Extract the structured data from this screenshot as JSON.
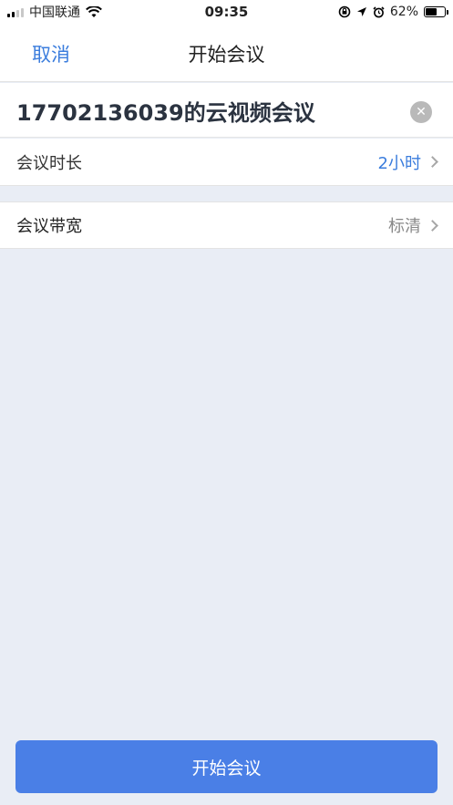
{
  "status_bar": {
    "carrier": "中国联通",
    "time": "09:35",
    "battery_percent_text": "62%",
    "battery_level": 0.62,
    "icons": [
      "signal-bars-icon",
      "wifi-icon",
      "screen-lock-rotation-icon",
      "location-arrow-icon",
      "alarm-clock-icon",
      "battery-icon"
    ]
  },
  "nav": {
    "cancel_label": "取消",
    "title": "开始会议"
  },
  "meeting": {
    "name_value": "17702136039的云视频会议"
  },
  "settings": {
    "duration_label": "会议时长",
    "duration_value": "2小时",
    "bandwidth_label": "会议带宽",
    "bandwidth_value": "标清"
  },
  "actions": {
    "start_label": "开始会议"
  },
  "colors": {
    "accent": "#3b7ddd",
    "button": "#4a7fe6",
    "background": "#e9edf5"
  }
}
